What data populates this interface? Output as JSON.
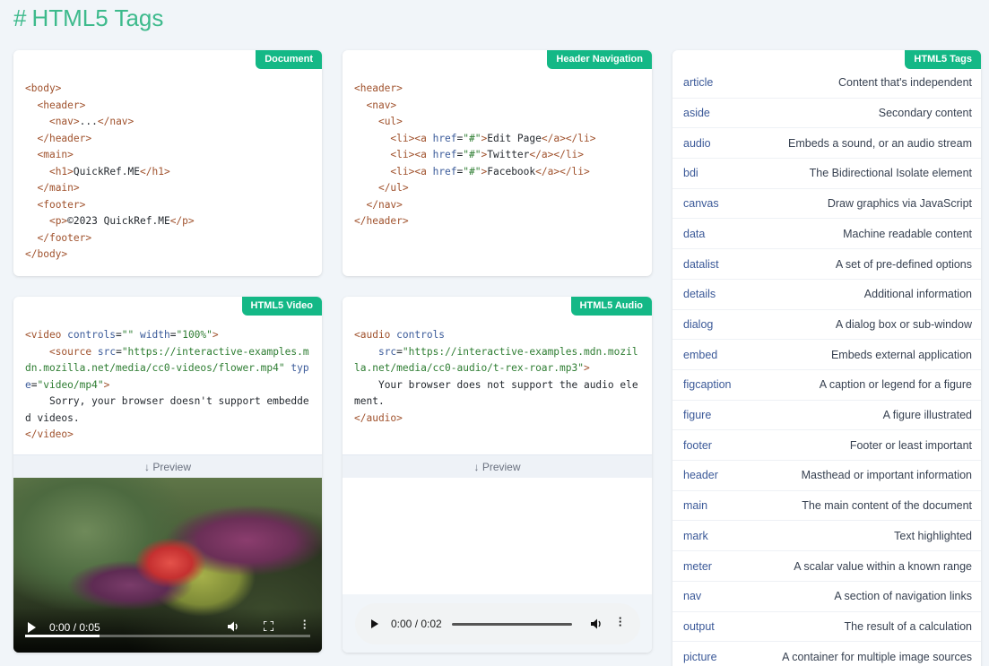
{
  "page": {
    "hash": "#",
    "title": "HTML5 Tags"
  },
  "cards": {
    "document": {
      "badge": "Document"
    },
    "header_nav": {
      "badge": "Header Navigation"
    },
    "video": {
      "badge": "HTML5 Video",
      "preview_label": "↓ Preview",
      "player": {
        "time": "0:00 / 0:05",
        "progress": 0.26
      }
    },
    "audio": {
      "badge": "HTML5 Audio",
      "preview_label": "↓ Preview",
      "player": {
        "time": "0:00 / 0:02",
        "progress": 0.0
      }
    },
    "tags": {
      "badge": "HTML5 Tags"
    }
  },
  "code": {
    "document": [
      [
        [
          "t",
          "<body>"
        ]
      ],
      [
        [
          "x",
          "  "
        ],
        [
          "t",
          "<header>"
        ]
      ],
      [
        [
          "x",
          "    "
        ],
        [
          "t",
          "<nav>"
        ],
        [
          "x",
          "..."
        ],
        [
          "t",
          "</nav>"
        ]
      ],
      [
        [
          "x",
          "  "
        ],
        [
          "t",
          "</header>"
        ]
      ],
      [
        [
          "x",
          "  "
        ],
        [
          "t",
          "<main>"
        ]
      ],
      [
        [
          "x",
          "    "
        ],
        [
          "t",
          "<h1>"
        ],
        [
          "x",
          "QuickRef.ME"
        ],
        [
          "t",
          "</h1>"
        ]
      ],
      [
        [
          "x",
          "  "
        ],
        [
          "t",
          "</main>"
        ]
      ],
      [
        [
          "x",
          "  "
        ],
        [
          "t",
          "<footer>"
        ]
      ],
      [
        [
          "x",
          "    "
        ],
        [
          "t",
          "<p>"
        ],
        [
          "x",
          "©2023 QuickRef.ME"
        ],
        [
          "t",
          "</p>"
        ]
      ],
      [
        [
          "x",
          "  "
        ],
        [
          "t",
          "</footer>"
        ]
      ],
      [
        [
          "t",
          "</body>"
        ]
      ]
    ],
    "header_nav": [
      [
        [
          "t",
          "<header>"
        ]
      ],
      [
        [
          "x",
          "  "
        ],
        [
          "t",
          "<nav>"
        ]
      ],
      [
        [
          "x",
          "    "
        ],
        [
          "t",
          "<ul>"
        ]
      ],
      [
        [
          "x",
          "      "
        ],
        [
          "t",
          "<li><a "
        ],
        [
          "a",
          "href"
        ],
        [
          "x",
          "="
        ],
        [
          "s",
          "\"#\""
        ],
        [
          "t",
          ">"
        ],
        [
          "x",
          "Edit Page"
        ],
        [
          "t",
          "</a></li>"
        ]
      ],
      [
        [
          "x",
          "      "
        ],
        [
          "t",
          "<li><a "
        ],
        [
          "a",
          "href"
        ],
        [
          "x",
          "="
        ],
        [
          "s",
          "\"#\""
        ],
        [
          "t",
          ">"
        ],
        [
          "x",
          "Twitter"
        ],
        [
          "t",
          "</a></li>"
        ]
      ],
      [
        [
          "x",
          "      "
        ],
        [
          "t",
          "<li><a "
        ],
        [
          "a",
          "href"
        ],
        [
          "x",
          "="
        ],
        [
          "s",
          "\"#\""
        ],
        [
          "t",
          ">"
        ],
        [
          "x",
          "Facebook"
        ],
        [
          "t",
          "</a></li>"
        ]
      ],
      [
        [
          "x",
          "    "
        ],
        [
          "t",
          "</ul>"
        ]
      ],
      [
        [
          "x",
          "  "
        ],
        [
          "t",
          "</nav>"
        ]
      ],
      [
        [
          "t",
          "</header>"
        ]
      ]
    ],
    "video": [
      [
        [
          "t",
          "<video "
        ],
        [
          "a",
          "controls"
        ],
        [
          "x",
          "="
        ],
        [
          "s",
          "\"\""
        ],
        [
          "x",
          " "
        ],
        [
          "a",
          "width"
        ],
        [
          "x",
          "="
        ],
        [
          "s",
          "\"100%\""
        ],
        [
          "t",
          ">"
        ]
      ],
      [
        [
          "x",
          "    "
        ],
        [
          "t",
          "<source "
        ],
        [
          "a",
          "src"
        ],
        [
          "x",
          "="
        ],
        [
          "s",
          "\"https://interactive-examples.mdn.mozilla.net/media/cc0-videos/flower.mp4\""
        ],
        [
          "x",
          " "
        ],
        [
          "a",
          "type"
        ],
        [
          "x",
          "="
        ],
        [
          "s",
          "\"video/mp4\""
        ],
        [
          "t",
          ">"
        ]
      ],
      [
        [
          "x",
          "    Sorry, your browser doesn't support embedded videos."
        ]
      ],
      [
        [
          "t",
          "</video>"
        ]
      ]
    ],
    "audio": [
      [
        [
          "t",
          "<audio "
        ],
        [
          "a",
          "controls"
        ]
      ],
      [
        [
          "x",
          "    "
        ],
        [
          "a",
          "src"
        ],
        [
          "x",
          "="
        ],
        [
          "s",
          "\"https://interactive-examples.mdn.mozilla.net/media/cc0-audio/t-rex-roar.mp3\""
        ],
        [
          "t",
          ">"
        ]
      ],
      [
        [
          "x",
          "    Your browser does not support the audio element."
        ]
      ],
      [
        [
          "t",
          "</audio>"
        ]
      ]
    ]
  },
  "tags": [
    {
      "name": "article",
      "desc": "Content that's independent"
    },
    {
      "name": "aside",
      "desc": "Secondary content"
    },
    {
      "name": "audio",
      "desc": "Embeds a sound, or an audio stream"
    },
    {
      "name": "bdi",
      "desc": "The Bidirectional Isolate element"
    },
    {
      "name": "canvas",
      "desc": "Draw graphics via JavaScript"
    },
    {
      "name": "data",
      "desc": "Machine readable content"
    },
    {
      "name": "datalist",
      "desc": "A set of pre-defined options"
    },
    {
      "name": "details",
      "desc": "Additional information"
    },
    {
      "name": "dialog",
      "desc": "A dialog box or sub-window"
    },
    {
      "name": "embed",
      "desc": "Embeds external application"
    },
    {
      "name": "figcaption",
      "desc": "A caption or legend for a figure"
    },
    {
      "name": "figure",
      "desc": "A figure illustrated"
    },
    {
      "name": "footer",
      "desc": "Footer or least important"
    },
    {
      "name": "header",
      "desc": "Masthead or important information"
    },
    {
      "name": "main",
      "desc": "The main content of the document"
    },
    {
      "name": "mark",
      "desc": "Text highlighted"
    },
    {
      "name": "meter",
      "desc": "A scalar value within a known range"
    },
    {
      "name": "nav",
      "desc": "A section of navigation links"
    },
    {
      "name": "output",
      "desc": "The result of a calculation"
    },
    {
      "name": "picture",
      "desc": "A container for multiple image sources"
    }
  ]
}
